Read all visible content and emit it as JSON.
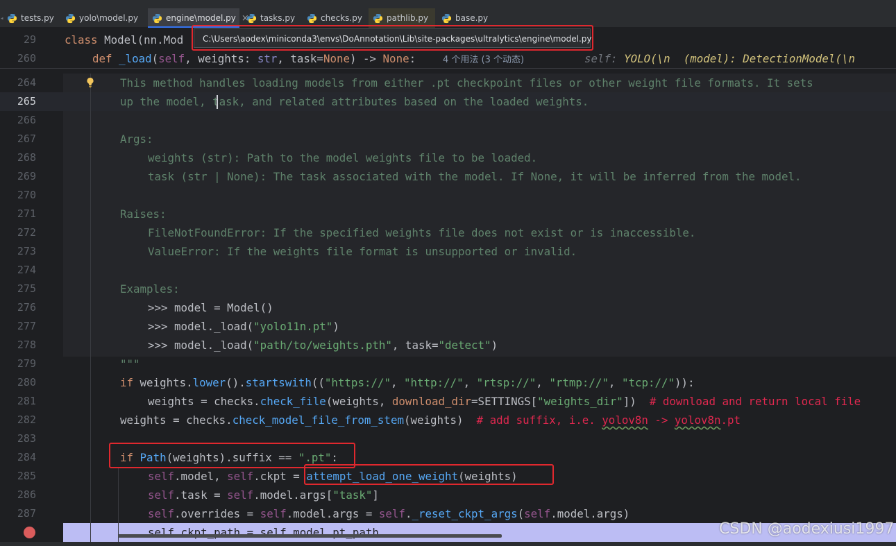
{
  "tabs": [
    {
      "label": "tests.py"
    },
    {
      "label": "yolo\\model.py"
    },
    {
      "label": "engine\\model.py",
      "close": "×"
    },
    {
      "label": "tasks.py"
    },
    {
      "label": "checks.py"
    },
    {
      "label": "pathlib.py"
    },
    {
      "label": "base.py"
    }
  ],
  "tooltip": {
    "path": "C:\\Users\\aodex\\miniconda3\\envs\\DoAnnotation\\Lib\\site-packages\\ultralytics\\engine\\model.py"
  },
  "sticky": {
    "line1_no": "29",
    "line1_kw": "class",
    "line1_name": "Model",
    "line1_rest": "(nn.Mod",
    "line2_no": "260",
    "line2_def": "def",
    "line2_name": "_load",
    "line2_p1": "(",
    "line2_self": "self",
    "line2_p2": ", weights: ",
    "line2_str": "str",
    "line2_p3": ", task=",
    "line2_none1": "None",
    "line2_p4": ") -> ",
    "line2_none2": "None",
    "line2_p5": ":",
    "usages": "4 个用法 (3 个动态)",
    "inlay_self": "self:",
    "inlay_yolo": "YOLO(\\n",
    "inlay_model": "(model): DetectionModel(\\n"
  },
  "lines": {
    "ln": [
      "264",
      "265",
      "266",
      "267",
      "268",
      "269",
      "270",
      "271",
      "272",
      "273",
      "274",
      "275",
      "276",
      "277",
      "278",
      "279",
      "280",
      "281",
      "282",
      "283",
      "284",
      "285",
      "286",
      "287"
    ],
    "l264": "This method handles loading models from either .pt checkpoint files or other weight file formats. It sets",
    "l265": "up the model, task, and related attributes based on the loaded weights.",
    "l267": "Args:",
    "l268": "weights (str): Path to the model weights file to be loaded.",
    "l269": "task (str | None): The task associated with the model. If None, it will be inferred from the model.",
    "l271": "Raises:",
    "l272": "FileNotFoundError: If the specified weights file does not exist or is inaccessible.",
    "l273": "ValueError: If the weights file format is unsupported or invalid.",
    "l275": "Examples:",
    "l276": ">>> model = Model()",
    "l277a": ">>> model._load(",
    "l277b": "\"yolo11n.pt\"",
    "l277c": ")",
    "l278a": ">>> model._load(",
    "l278b": "\"path/to/weights.pth\"",
    "l278c": ", task=",
    "l278d": "\"detect\"",
    "l278e": ")",
    "l279": "\"\"\"",
    "l280": {
      "kw": "if",
      "a": " weights.",
      "f1": "lower",
      "b": "().",
      "f2": "startswith",
      "c": "((",
      "s1": "\"https://\"",
      "d": ", ",
      "s2": "\"http://\"",
      "e": ", ",
      "s3": "\"rtsp://\"",
      "f": ", ",
      "s4": "\"rtmp://\"",
      "g": ", ",
      "s5": "\"tcp://\"",
      "h": ")):"
    },
    "l281": {
      "a": "weights = checks.",
      "f": "check_file",
      "b": "(weights, ",
      "p": "download_dir",
      "c": "=SETTINGS[",
      "s": "\"weights_dir\"",
      "d": "])  ",
      "cm": "# download and return local file"
    },
    "l282": {
      "a": "weights = checks.",
      "f": "check_model_file_from_stem",
      "b": "(weights)  ",
      "cm1": "# add suffix, i.e. ",
      "cm2": "yolov8n",
      "cm3": " -> ",
      "cm4": "yolov8n",
      "cm5": ".pt"
    },
    "l284": {
      "kw": "if",
      "sp": " ",
      "cls": "Path",
      "a": "(weights).suffix == ",
      "s": "\".pt\"",
      "b": ":"
    },
    "l285": {
      "self1": "self",
      "a": ".model, ",
      "self2": "self",
      "b": ".ckpt = ",
      "f": "attempt_load_one_weight",
      "c": "(weights)"
    },
    "l286": {
      "self1": "self",
      "a": ".task = ",
      "self2": "self",
      "b": ".model.args[",
      "s": "\"task\"",
      "c": "]"
    },
    "l287": {
      "self1": "self",
      "a": ".overrides = ",
      "self2": "self",
      "b": ".model.args = ",
      "self3": "self",
      "c": ".",
      "f": "_reset_ckpt_args",
      "d": "(",
      "self4": "self",
      "e": ".model.args)"
    },
    "l288": "self.ckpt_path = self.model.pt_path"
  },
  "watermark": "CSDN @aodexiusi1997",
  "colors": {
    "highlight_box": "#e0282e",
    "breakpoint": "#db5c5c",
    "current_exec_line": "#bcbdf4"
  }
}
